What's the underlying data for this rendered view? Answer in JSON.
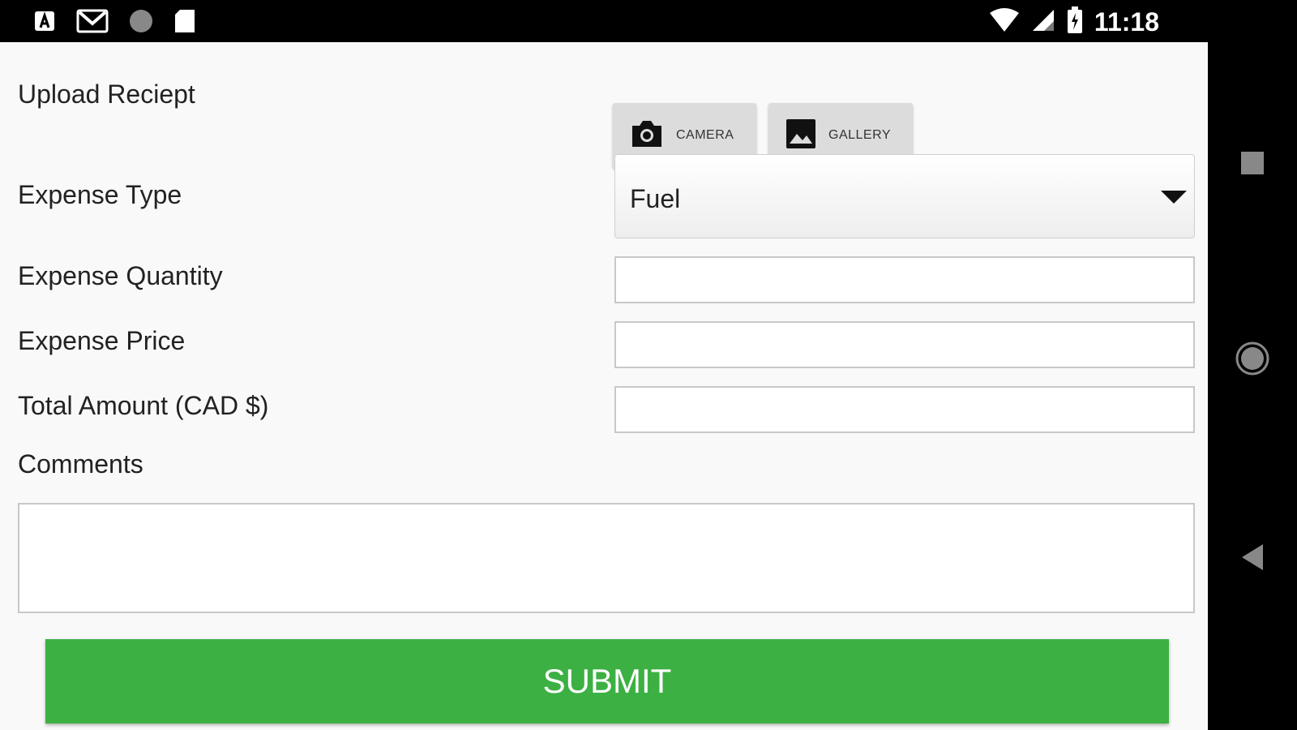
{
  "status_bar": {
    "time": "11:18",
    "icons": [
      "app-icon",
      "gmail-icon",
      "circle-icon",
      "sd-card-icon",
      "wifi-icon",
      "cell-signal-icon",
      "battery-icon"
    ]
  },
  "form": {
    "upload_label": "Upload Reciept",
    "camera_label": "CAMERA",
    "gallery_label": "GALLERY",
    "expense_type_label": "Expense Type",
    "expense_type_value": "Fuel",
    "quantity_label": "Expense Quantity",
    "quantity_value": "",
    "price_label": "Expense Price",
    "price_value": "",
    "total_label": "Total Amount (CAD $)",
    "total_value": "",
    "comments_label": "Comments",
    "comments_value": "",
    "submit_label": "SUBMIT"
  },
  "colors": {
    "submit_bg": "#3cb043",
    "app_bg": "#f9f9f9",
    "media_button_bg": "#dcdcdc"
  },
  "nav_bar": {
    "icons": [
      "recents-icon",
      "home-icon",
      "back-icon"
    ]
  }
}
